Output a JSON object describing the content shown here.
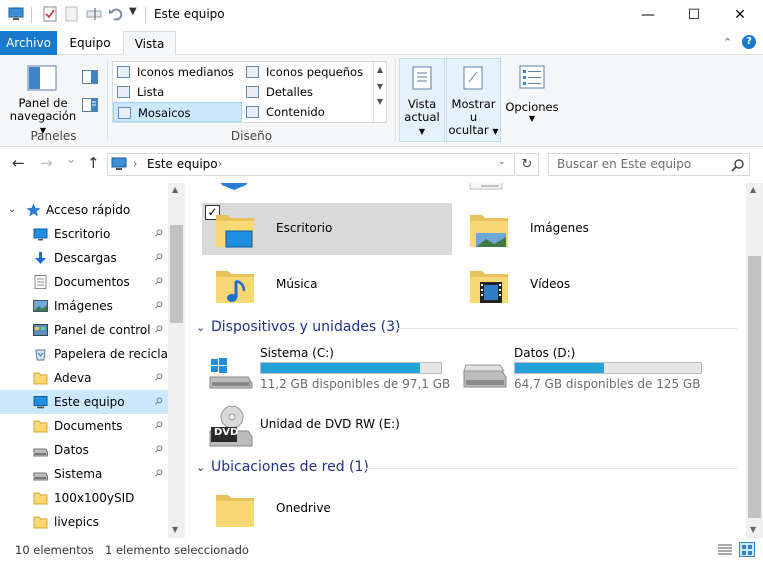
{
  "window": {
    "title": "Este equipo",
    "minimize_glyph": "—",
    "maximize_glyph": "☐",
    "close_glyph": "✕"
  },
  "ribbon_tabs": [
    "Archivo",
    "Equipo",
    "Vista"
  ],
  "ribbon": {
    "panes_group": {
      "nav_pane_label_1": "Panel de",
      "nav_pane_label_2": "navegación",
      "group_label": "Paneles"
    },
    "layout_group": {
      "items": [
        "Iconos medianos",
        "Iconos pequeños",
        "Lista",
        "Detalles",
        "Mosaicos",
        "Contenido"
      ],
      "selected": "Mosaicos",
      "group_label": "Diseño"
    },
    "view_group": {
      "current_view_1": "Vista",
      "current_view_2": "actual",
      "show_hide_1": "Mostrar u",
      "show_hide_2": "ocultar",
      "options": "Opciones"
    }
  },
  "navbar": {
    "back_glyph": "←",
    "forward_glyph": "→",
    "recent_glyph": "⌄",
    "up_glyph": "↑",
    "address_location": "Este equipo",
    "refresh_glyph": "↻",
    "search_placeholder": "Buscar en Este equipo"
  },
  "sidebar": {
    "quick_access": "Acceso rápido",
    "items": [
      {
        "label": "Escritorio",
        "icon": "desktop-icon",
        "pinned": true
      },
      {
        "label": "Descargas",
        "icon": "download-icon",
        "pinned": true
      },
      {
        "label": "Documentos",
        "icon": "document-icon",
        "pinned": true
      },
      {
        "label": "Imágenes",
        "icon": "pictures-icon",
        "pinned": true
      },
      {
        "label": "Panel de control",
        "icon": "control-panel-icon",
        "pinned": true
      },
      {
        "label": "Papelera de recicla",
        "icon": "recycle-bin-icon",
        "pinned": false
      },
      {
        "label": "Adeva",
        "icon": "folder-icon",
        "pinned": true
      },
      {
        "label": "Este equipo",
        "icon": "computer-icon",
        "pinned": true,
        "selected": true
      },
      {
        "label": "Documents",
        "icon": "folder-icon",
        "pinned": true
      },
      {
        "label": "Datos",
        "icon": "drive-icon",
        "pinned": true
      },
      {
        "label": "Sistema",
        "icon": "drive-icon",
        "pinned": true
      },
      {
        "label": "100x100ySID",
        "icon": "folder-icon",
        "pinned": false
      },
      {
        "label": "livepics",
        "icon": "folder-icon",
        "pinned": false
      }
    ]
  },
  "content": {
    "folders": [
      {
        "label": "Escritorio",
        "icon": "desktop-folder-icon",
        "selected": true
      },
      {
        "label": "Imágenes",
        "icon": "pictures-folder-icon"
      },
      {
        "label": "Música",
        "icon": "music-folder-icon"
      },
      {
        "label": "Vídeos",
        "icon": "videos-folder-icon"
      }
    ],
    "devices_section": "Dispositivos y unidades (3)",
    "drives": [
      {
        "label": "Sistema (C:)",
        "free": "11,2 GB disponibles de 97,1 GB",
        "used_fraction": 0.885,
        "icon": "windows-drive-icon"
      },
      {
        "label": "Datos (D:)",
        "free": "64,7 GB disponibles de 125 GB",
        "used_fraction": 0.48,
        "icon": "drive-icon"
      },
      {
        "label": "Unidad de DVD RW (E:)",
        "icon": "dvd-drive-icon",
        "dvd_text": "DVD"
      }
    ],
    "network_section": "Ubicaciones de red (1)",
    "network": [
      {
        "label": "Onedrive",
        "icon": "folder-icon"
      }
    ]
  },
  "status": {
    "count": "10 elementos",
    "selection": "1 elemento seleccionado"
  },
  "colors": {
    "accent": "#1979ca",
    "selection": "#cce8ff",
    "selected_tile": "#d9d9d9",
    "drive_bar": "#26a0da",
    "section_text": "#1e3287"
  }
}
